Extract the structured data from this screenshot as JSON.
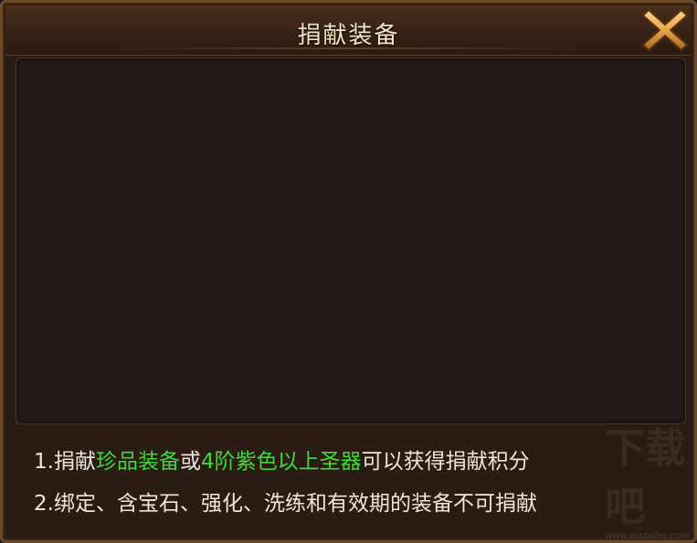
{
  "dialog": {
    "title": "捐献装备",
    "close_icon": "close-x-icon"
  },
  "content_panel": {
    "items": []
  },
  "notes": [
    {
      "prefix": "1.捐献",
      "highlight1": "珍品装备",
      "middle": "或",
      "highlight2": "4阶紫色以上圣器",
      "suffix": "可以获得捐献积分"
    },
    {
      "text": "2.绑定、含宝石、强化、洗练和有效期的装备不可捐献"
    }
  ],
  "colors": {
    "highlight": "#3fd83a",
    "text": "#ece6dc",
    "title": "#f3e4c6",
    "close_icon": "#e8a54a"
  },
  "watermark": {
    "mark": "下载吧",
    "url": "www.xiazaiba.com"
  }
}
